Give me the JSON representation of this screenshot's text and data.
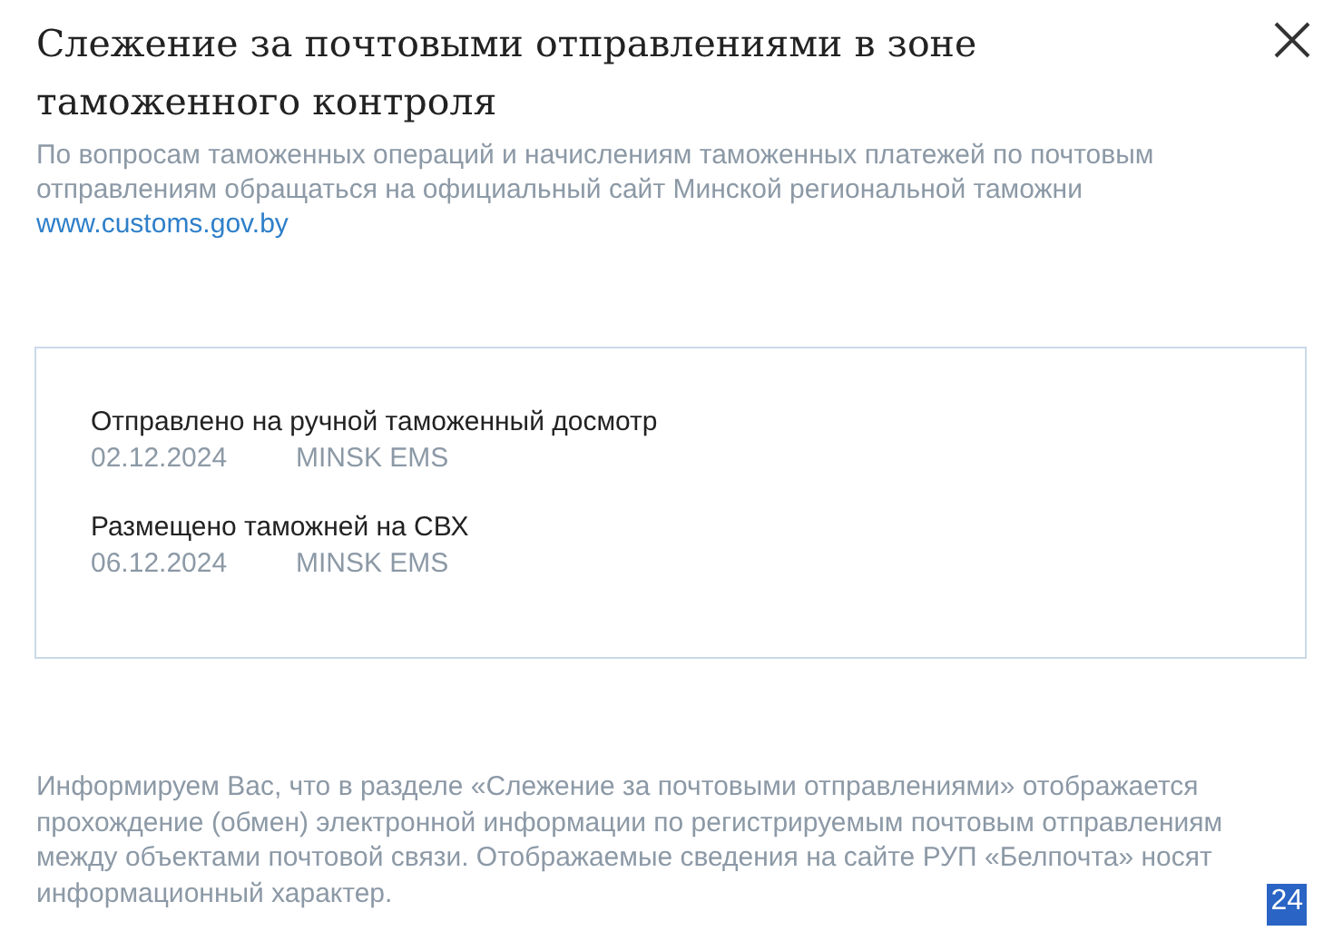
{
  "title": "Слежение за почтовыми отправлениями в зоне таможенного контроля",
  "note": "По вопросам таможенных операций и начислениям таможенных платежей по почтовым отправлениям обращаться на официальный сайт Минской региональной таможни",
  "link": "www.customs.gov.by",
  "events": [
    {
      "status": "Отправлено на ручной таможенный досмотр",
      "date": "02.12.2024",
      "office": "MINSK EMS"
    },
    {
      "status": "Размещено таможней на СВХ",
      "date": "06.12.2024",
      "office": "MINSK EMS"
    }
  ],
  "footer": "Информируем Вас, что в разделе «Слежение за почтовыми отправлениями» отображается прохождение (обмен) электронной информации по регистрируемым почтовым отправлениям между объектами почтовой связи. Отображаемые сведения на сайте РУП «Белпочта» носят информационный характер.",
  "counter_badge": "24"
}
